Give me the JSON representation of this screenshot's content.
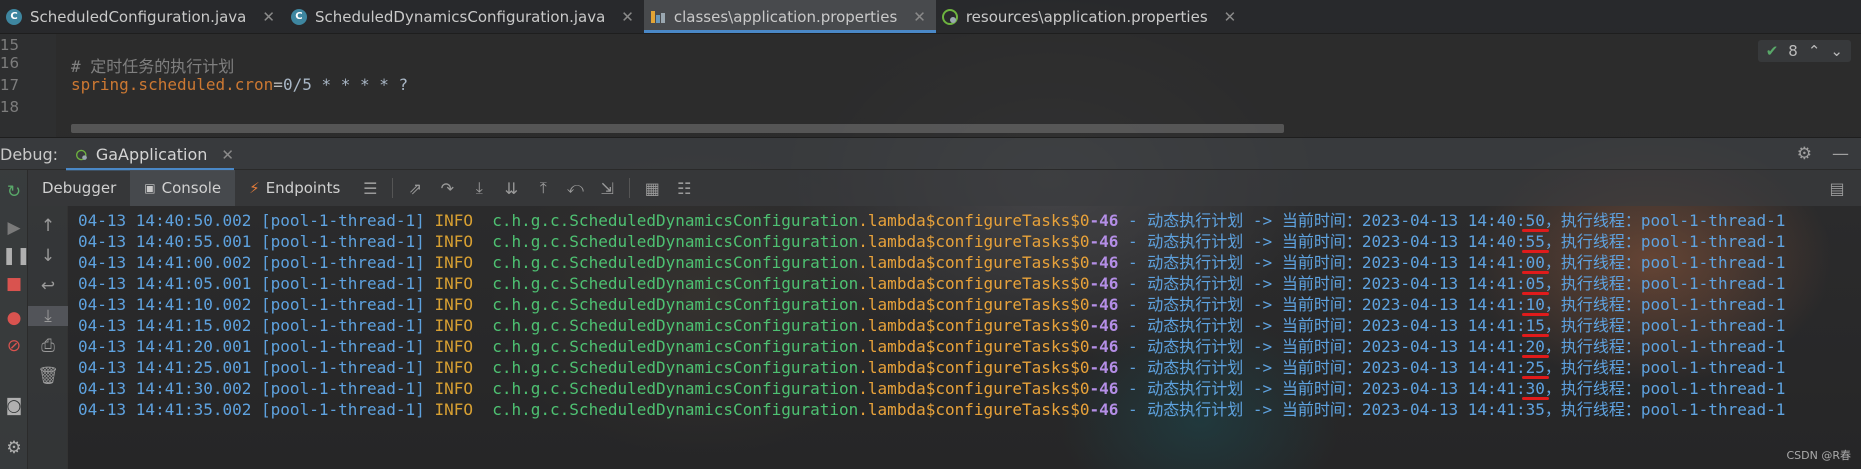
{
  "tabs": [
    {
      "label": "ScheduledConfiguration.java",
      "icon": "java-class-icon"
    },
    {
      "label": "ScheduledDynamicsConfiguration.java",
      "icon": "java-class-icon"
    },
    {
      "label": "classes\\application.properties",
      "icon": "properties-file-icon"
    },
    {
      "label": "resources\\application.properties",
      "icon": "spring-properties-icon"
    }
  ],
  "editor": {
    "line_numbers": [
      "15",
      "16",
      "17",
      "18"
    ],
    "comment": "# 定时任务的执行计划",
    "prop_key": "spring.scheduled.cron",
    "prop_eq": "=",
    "prop_value": "0/5 * * * * ?",
    "inspection_count": "8"
  },
  "debug": {
    "label": "Debug:",
    "session": "GaApplication",
    "subtabs": {
      "debugger": "Debugger",
      "console": "Console",
      "endpoints": "Endpoints"
    }
  },
  "log": {
    "thread": "[pool-1-thread-1]",
    "level": "INFO",
    "class": "c.h.g.c.ScheduledDynamicsConfiguration",
    "method": ".lambda$configureTasks$0",
    "line": "-46",
    "sep": " - ",
    "message": "动态执行计划 -> 当前时间：2023-04-13 14:",
    "thread_label": "，执行线程：",
    "thread_name": "pool-1-thread-1",
    "rows": [
      {
        "ts": "04-13 14:40:50.002",
        "min": "40:",
        "sec": "50"
      },
      {
        "ts": "04-13 14:40:55.001",
        "min": "40:",
        "sec": "55"
      },
      {
        "ts": "04-13 14:41:00.002",
        "min": "41:",
        "sec": "00"
      },
      {
        "ts": "04-13 14:41:05.001",
        "min": "41:",
        "sec": "05"
      },
      {
        "ts": "04-13 14:41:10.002",
        "min": "41:",
        "sec": "10"
      },
      {
        "ts": "04-13 14:41:15.002",
        "min": "41:",
        "sec": "15"
      },
      {
        "ts": "04-13 14:41:20.001",
        "min": "41:",
        "sec": "20"
      },
      {
        "ts": "04-13 14:41:25.001",
        "min": "41:",
        "sec": "25"
      },
      {
        "ts": "04-13 14:41:30.002",
        "min": "41:",
        "sec": "30"
      },
      {
        "ts": "04-13 14:41:35.002",
        "min": "41:",
        "sec": "35"
      }
    ]
  },
  "watermark": "CSDN @R春"
}
